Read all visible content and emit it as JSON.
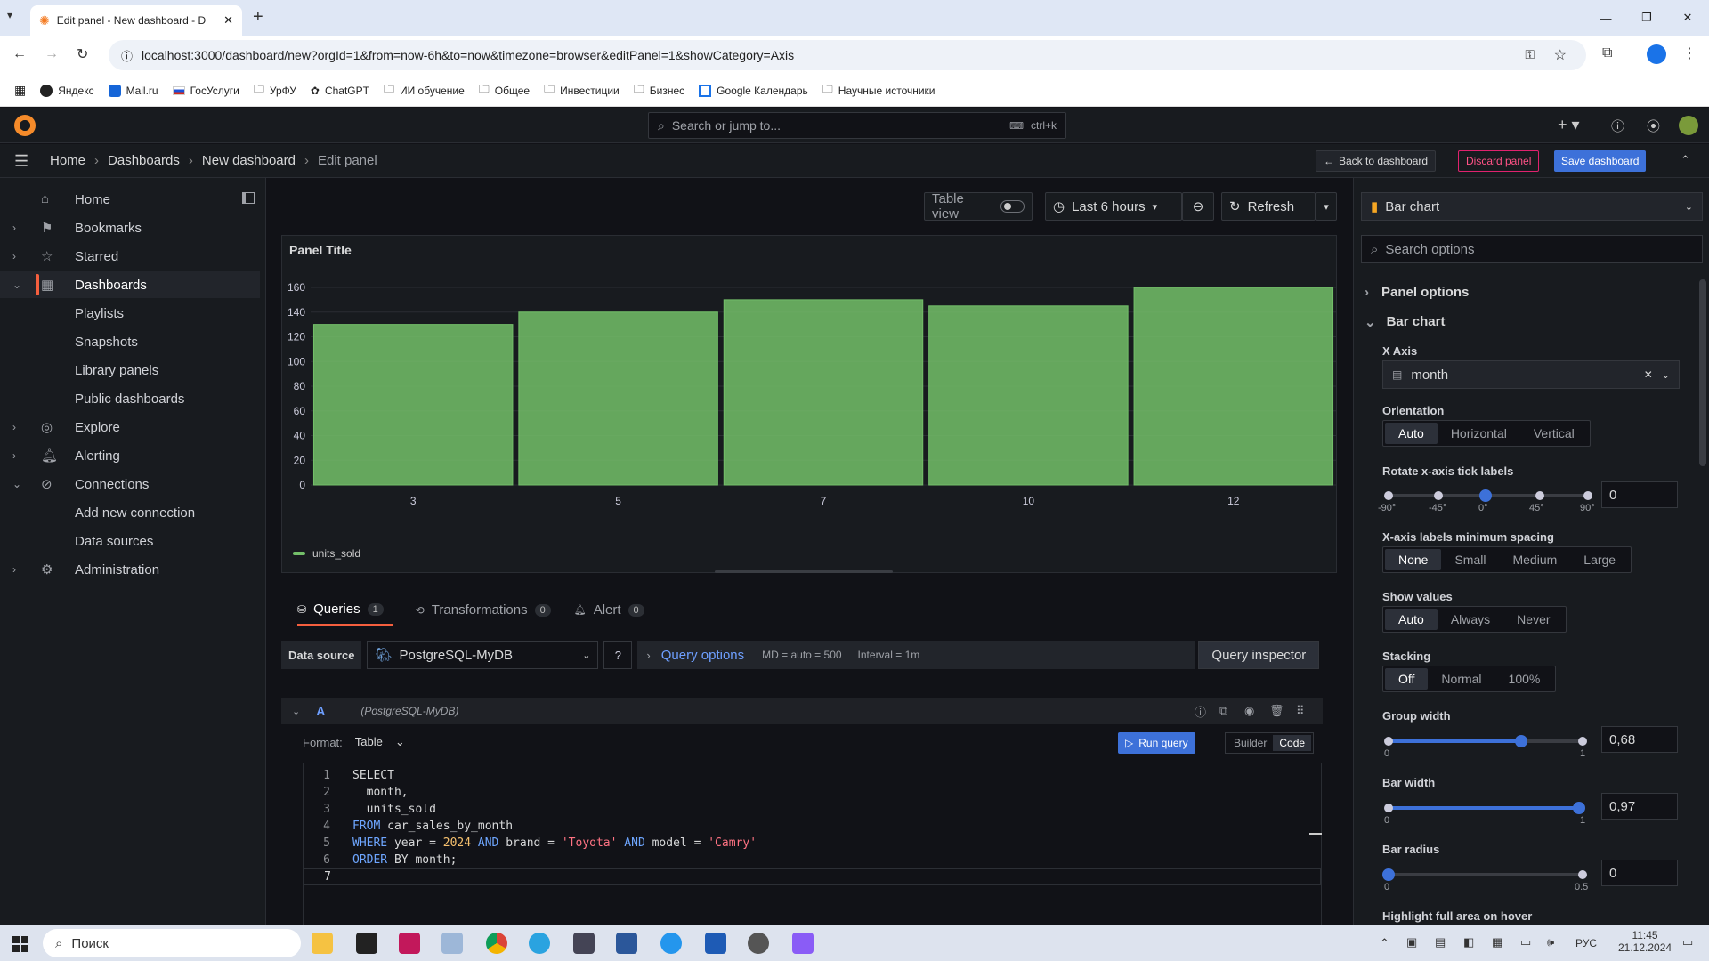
{
  "browser": {
    "tab_title": "Edit panel - New dashboard - D",
    "url": "localhost:3000/dashboard/new?orgId=1&from=now-6h&to=now&timezone=browser&editPanel=1&showCategory=Axis",
    "bookmarks": [
      "Яндекс",
      "Mail.ru",
      "ГосУслуги",
      "УрФУ",
      "ChatGPT",
      "ИИ обучение",
      "Общее",
      "Инвестиции",
      "Бизнес",
      "Google Календарь",
      "Научные источники"
    ]
  },
  "topbar": {
    "search_placeholder": "Search or jump to...",
    "search_shortcut": "ctrl+k"
  },
  "breadcrumb": [
    "Home",
    "Dashboards",
    "New dashboard",
    "Edit panel"
  ],
  "actions": {
    "back": "Back to dashboard",
    "discard": "Discard panel",
    "save": "Save dashboard"
  },
  "sidebar": {
    "items": [
      {
        "label": "Home",
        "icon": "home-icon"
      },
      {
        "label": "Bookmarks",
        "icon": "bookmark-icon"
      },
      {
        "label": "Starred",
        "icon": "star-icon"
      },
      {
        "label": "Dashboards",
        "icon": "apps-icon"
      },
      {
        "label": "Playlists"
      },
      {
        "label": "Snapshots"
      },
      {
        "label": "Library panels"
      },
      {
        "label": "Public dashboards"
      },
      {
        "label": "Explore",
        "icon": "compass-icon"
      },
      {
        "label": "Alerting",
        "icon": "bell-icon"
      },
      {
        "label": "Connections",
        "icon": "plug-icon"
      },
      {
        "label": "Add new connection"
      },
      {
        "label": "Data sources"
      },
      {
        "label": "Administration",
        "icon": "cog-icon"
      }
    ]
  },
  "panel_toolbar": {
    "table_view": "Table view",
    "time_range": "Last 6 hours",
    "refresh": "Refresh"
  },
  "panel": {
    "title": "Panel Title",
    "legend": "units_sold",
    "series_color": "#73bf69"
  },
  "chart_data": {
    "type": "bar",
    "categories": [
      "3",
      "5",
      "7",
      "10",
      "12"
    ],
    "series": [
      {
        "name": "units_sold",
        "values": [
          130,
          140,
          150,
          145,
          160
        ]
      }
    ],
    "yticks": [
      0,
      20,
      40,
      60,
      80,
      100,
      120,
      140,
      160
    ],
    "ylim": [
      0,
      160
    ],
    "title": "Panel Title",
    "legend": "bottom-left"
  },
  "query_tabs": [
    {
      "label": "Queries",
      "count": "1"
    },
    {
      "label": "Transformations",
      "count": "0"
    },
    {
      "label": "Alert",
      "count": "0"
    }
  ],
  "datasource": {
    "label": "Data source",
    "value": "PostgreSQL-MyDB",
    "query_options": "Query options",
    "md": "MD = auto = 500",
    "interval": "Interval = 1m",
    "inspector": "Query inspector"
  },
  "query": {
    "ref": "A",
    "ds": "(PostgreSQL-MyDB)",
    "format_label": "Format:",
    "format_value": "Table",
    "run": "Run query",
    "builder": "Builder",
    "code": "Code",
    "lines": [
      "SELECT",
      "  month,",
      "  units_sold",
      "FROM car_sales_by_month",
      "WHERE year = 2024 AND brand = 'Toyota' AND model = 'Camry'",
      "ORDER BY month;",
      ""
    ]
  },
  "options": {
    "viz": "Bar chart",
    "search_placeholder": "Search options",
    "panel_options": "Panel options",
    "bar_chart": "Bar chart",
    "x_axis_label": "X Axis",
    "x_axis_value": "month",
    "orientation_label": "Orientation",
    "orientation": [
      "Auto",
      "Horizontal",
      "Vertical"
    ],
    "rotate_label": "Rotate x-axis tick labels",
    "rotate_ticks": [
      "-90°",
      "-45°",
      "0°",
      "45°",
      "90°"
    ],
    "rotate_value": "0",
    "spacing_label": "X-axis labels minimum spacing",
    "spacing": [
      "None",
      "Small",
      "Medium",
      "Large"
    ],
    "show_values_label": "Show values",
    "show_values": [
      "Auto",
      "Always",
      "Never"
    ],
    "stacking_label": "Stacking",
    "stacking": [
      "Off",
      "Normal",
      "100%"
    ],
    "group_width_label": "Group width",
    "group_width_min": "0",
    "group_width_max": "1",
    "group_width_value": "0,68",
    "group_width_fraction": 0.68,
    "bar_width_label": "Bar width",
    "bar_width_min": "0",
    "bar_width_max": "1",
    "bar_width_value": "0,97",
    "bar_width_fraction": 0.97,
    "bar_radius_label": "Bar radius",
    "bar_radius_min": "0",
    "bar_radius_max": "0.5",
    "bar_radius_value": "0",
    "highlight_label": "Highlight full area on hover"
  },
  "taskbar": {
    "search": "Поиск",
    "lang": "РУС",
    "time": "11:45",
    "date": "21.12.2024"
  }
}
